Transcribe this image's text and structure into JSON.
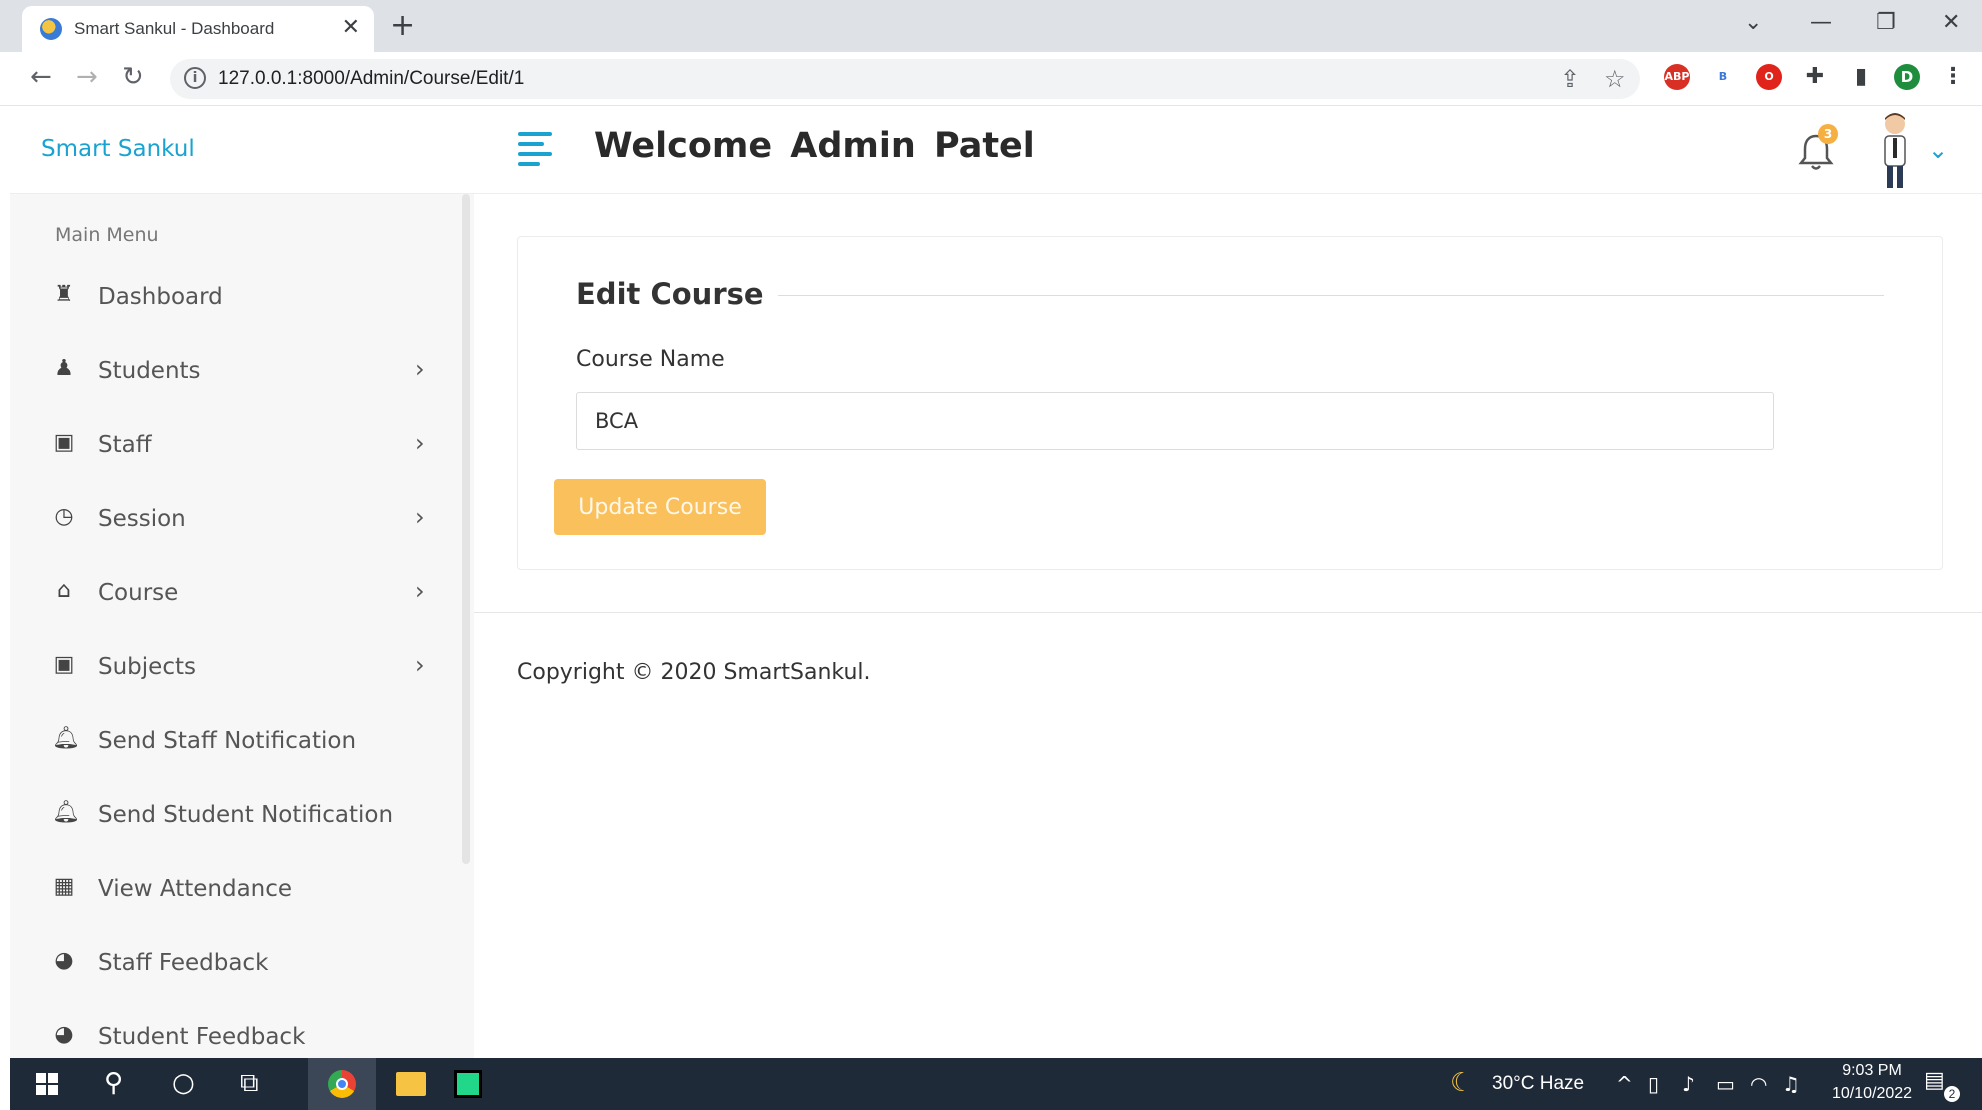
{
  "browser": {
    "tab_title": "Smart Sankul - Dashboard",
    "url": "127.0.0.1:8000/Admin/Course/Edit/1",
    "profile_initial": "D",
    "extensions": [
      "ABP",
      "B"
    ]
  },
  "sidebar": {
    "brand": "Smart Sankul",
    "section_header": "Main Menu",
    "items": [
      {
        "label": "Dashboard",
        "icon": "dashboard-icon",
        "chevron": false
      },
      {
        "label": "Students",
        "icon": "student-icon",
        "chevron": true
      },
      {
        "label": "Staff",
        "icon": "staff-icon",
        "chevron": true
      },
      {
        "label": "Session",
        "icon": "clock-icon",
        "chevron": true
      },
      {
        "label": "Course",
        "icon": "graduation-cap-icon",
        "chevron": true
      },
      {
        "label": "Subjects",
        "icon": "chalkboard-icon",
        "chevron": true
      },
      {
        "label": "Send Staff Notification",
        "icon": "bell-icon",
        "chevron": false
      },
      {
        "label": "Send Student Notification",
        "icon": "bell-icon",
        "chevron": false
      },
      {
        "label": "View Attendance",
        "icon": "calendar-icon",
        "chevron": false
      },
      {
        "label": "Staff Feedback",
        "icon": "comments-icon",
        "chevron": false
      },
      {
        "label": "Student Feedback",
        "icon": "comments-icon",
        "chevron": false
      }
    ]
  },
  "header": {
    "welcome": "Welcome  Admin Patel",
    "notification_count": "3"
  },
  "form": {
    "title": "Edit Course",
    "course_label": "Course Name",
    "course_value": "BCA",
    "submit_label": "Update Course"
  },
  "footer": {
    "copyright": "Copyright © 2020 SmartSankul."
  },
  "taskbar": {
    "weather": "30°C  Haze",
    "time": "9:03 PM",
    "date": "10/10/2022",
    "notification_count": "2"
  },
  "colors": {
    "accent": "#1aa3d1",
    "button": "#f9c05b",
    "taskbar": "#1f2a38"
  }
}
